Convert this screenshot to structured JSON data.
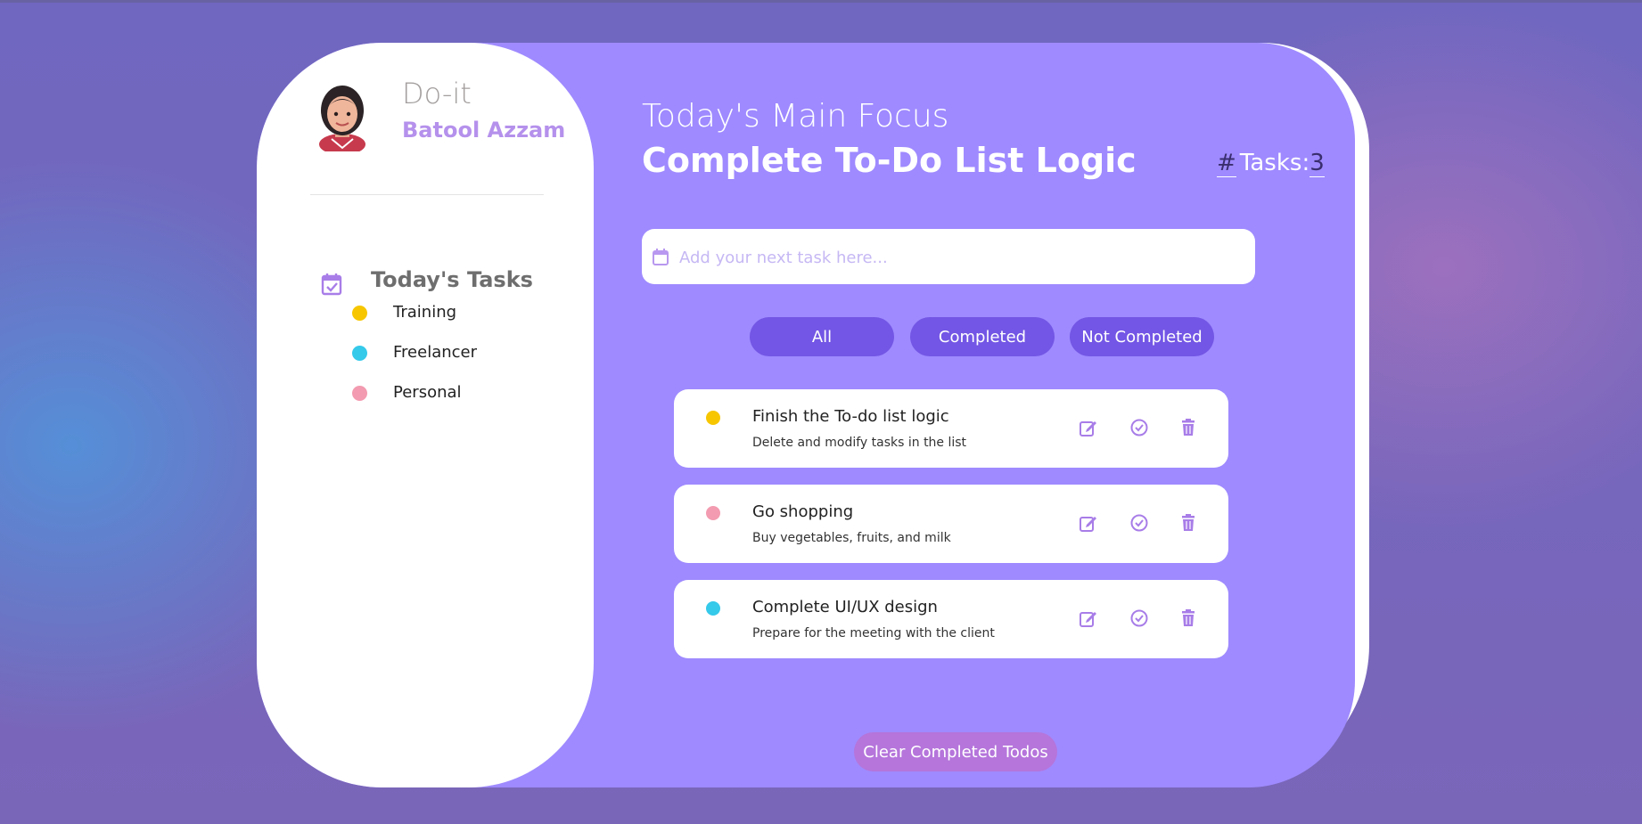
{
  "app": {
    "brand": "Do-it",
    "user_name": "Batool Azzam"
  },
  "sidebar": {
    "heading": "Today's Tasks",
    "categories": [
      {
        "label": "Training",
        "color": "#f7c600"
      },
      {
        "label": "Freelancer",
        "color": "#35c9ea"
      },
      {
        "label": "Personal",
        "color": "#f39bb0"
      }
    ]
  },
  "main": {
    "focus_label": "Today's Main Focus",
    "focus_title": "Complete To-Do List Logic",
    "task_count_hash": "#",
    "task_count_label": "Tasks:",
    "task_count_value": "3",
    "input_placeholder": "Add your next task here..."
  },
  "filters": [
    {
      "label": "All"
    },
    {
      "label": "Completed"
    },
    {
      "label": "Not Completed"
    }
  ],
  "tasks": [
    {
      "title": "Finish the To-do list logic",
      "description": "Delete and modify tasks in the list",
      "color": "#f7c600"
    },
    {
      "title": "Go shopping",
      "description": "Buy vegetables, fruits, and milk",
      "color": "#f39bb0"
    },
    {
      "title": "Complete UI/UX design",
      "description": "Prepare for the meeting with the client",
      "color": "#35c9ea"
    }
  ],
  "footer": {
    "clear_label": "Clear Completed Todos"
  },
  "icons": {
    "calendar": "calendar-check-icon",
    "edit": "edit-icon",
    "complete": "check-circle-icon",
    "delete": "trash-icon"
  },
  "colors": {
    "accent": "#9f8aff",
    "button": "#7356e5",
    "clear_button": "#b575db",
    "brand_name": "#b591ec"
  }
}
